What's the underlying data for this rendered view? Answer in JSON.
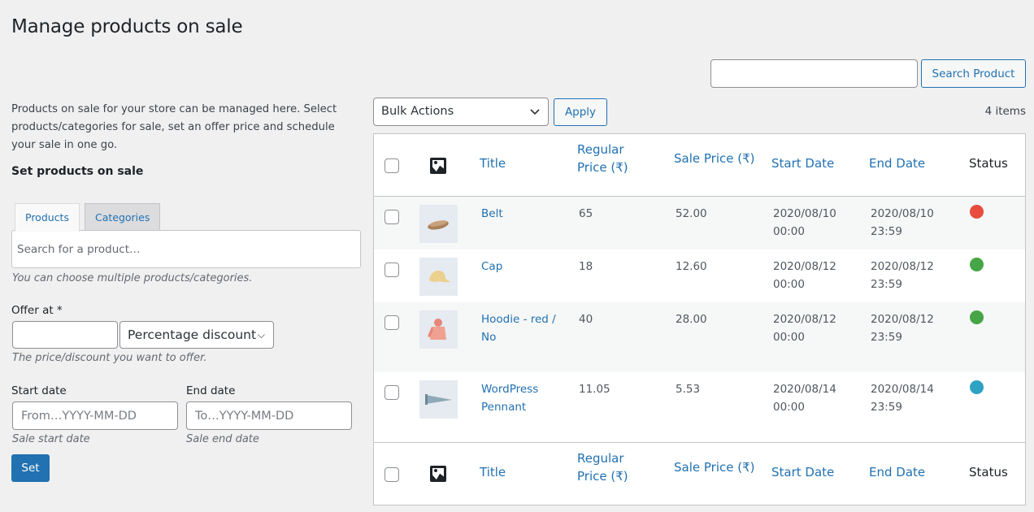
{
  "page": {
    "title": "Manage products on sale",
    "description": "Products on sale for your store can be managed here. Select products/categories for sale, set an offer price and schedule your sale in one go.",
    "subheading": "Set products on sale"
  },
  "form": {
    "tabs": [
      {
        "label": "Products",
        "active": true
      },
      {
        "label": "Categories",
        "active": false
      }
    ],
    "product_search_placeholder": "Search for a product…",
    "product_hint": "You can choose multiple products/categories.",
    "offer_label": "Offer at *",
    "offer_value": "",
    "offer_type": "Percentage discount",
    "offer_hint": "The price/discount you want to offer.",
    "start_label": "Start date",
    "start_placeholder": "From…YYYY-MM-DD",
    "start_hint": "Sale start date",
    "end_label": "End date",
    "end_placeholder": "To…YYYY-MM-DD",
    "end_hint": "Sale end date",
    "set_label": "Set"
  },
  "toolbar": {
    "search_value": "",
    "search_button": "Search Product",
    "bulk_actions": "Bulk Actions",
    "apply_label": "Apply",
    "item_count": "4 items"
  },
  "table": {
    "columns": {
      "image": "image-icon",
      "title": "Title",
      "regular_l1": "Regular",
      "regular_l2": "Price (₹)",
      "sale": "Sale Price (₹)",
      "start": "Start Date",
      "end": "End Date",
      "status": "Status"
    },
    "rows": [
      {
        "title_l1": "Belt",
        "title_l2": "",
        "thumb": "belt",
        "regular": "65",
        "sale": "52.00",
        "start_date": "2020/08/10",
        "start_time": "00:00",
        "end_date": "2020/08/10",
        "end_time": "23:59",
        "status_color": "#e74c3c",
        "status": "expired"
      },
      {
        "title_l1": "Cap",
        "title_l2": "",
        "thumb": "cap",
        "regular": "18",
        "sale": "12.60",
        "start_date": "2020/08/12",
        "start_time": "00:00",
        "end_date": "2020/08/12",
        "end_time": "23:59",
        "status_color": "#46a546",
        "status": "active"
      },
      {
        "title_l1": "Hoodie - red /",
        "title_l2": "No",
        "thumb": "hoodie",
        "regular": "40",
        "sale": "28.00",
        "start_date": "2020/08/12",
        "start_time": "00:00",
        "end_date": "2020/08/12",
        "end_time": "23:59",
        "status_color": "#46a546",
        "status": "active"
      },
      {
        "title_l1": "WordPress",
        "title_l2": "Pennant",
        "thumb": "pennant",
        "regular": "11.05",
        "sale": "5.53",
        "start_date": "2020/08/14",
        "start_time": "00:00",
        "end_date": "2020/08/14",
        "end_time": "23:59",
        "status_color": "#2ea2c2",
        "status": "scheduled"
      }
    ]
  },
  "colors": {
    "accent": "#2271b1",
    "background": "#f0f0f1"
  }
}
